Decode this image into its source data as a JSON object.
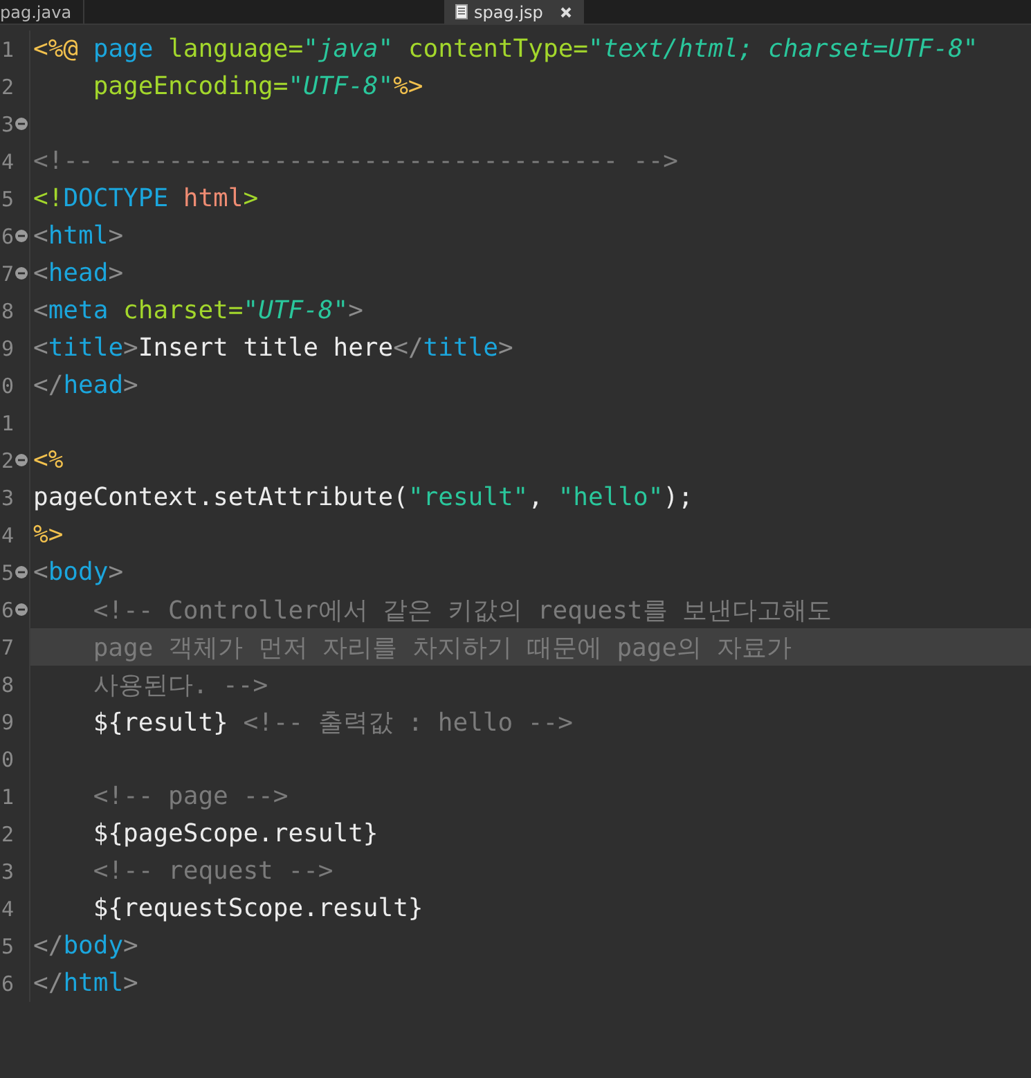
{
  "tabs": [
    {
      "label": "pag.java",
      "selected": false
    },
    {
      "label": "spag.jsp",
      "selected": true
    }
  ],
  "lines": [
    {
      "number": "1",
      "fold": false,
      "current": false,
      "tokens": [
        {
          "kind": "jsp",
          "text": "<%@"
        },
        {
          "kind": "tag",
          "text": " page"
        },
        {
          "kind": "attr",
          "text": " language="
        },
        {
          "kind": "str",
          "text": "\"java\""
        },
        {
          "kind": "attr",
          "text": " contentType="
        },
        {
          "kind": "str",
          "text": "\"text/html; charset=UTF-8\""
        }
      ]
    },
    {
      "number": "2",
      "fold": false,
      "current": false,
      "tokens": [
        {
          "kind": "attr",
          "text": "    pageEncoding="
        },
        {
          "kind": "str",
          "text": "\"UTF-8\""
        },
        {
          "kind": "jsp",
          "text": "%>"
        }
      ]
    },
    {
      "number": "3",
      "fold": true,
      "current": false
    },
    {
      "number": "4",
      "fold": false,
      "current": false,
      "tokens": [
        {
          "kind": "comment",
          "text": "<!-- ---------------------------------- -->"
        }
      ]
    },
    {
      "number": "5",
      "fold": false,
      "current": false,
      "tokens": [
        {
          "kind": "decl",
          "text": "<!"
        },
        {
          "kind": "tag",
          "text": "DOCTYPE"
        },
        {
          "kind": "name",
          "text": " html"
        },
        {
          "kind": "decl",
          "text": ">"
        }
      ]
    },
    {
      "number": "6",
      "fold": true,
      "current": false,
      "tokens": [
        {
          "kind": "punct",
          "text": "<"
        },
        {
          "kind": "tag",
          "text": "html"
        },
        {
          "kind": "punct",
          "text": ">"
        }
      ]
    },
    {
      "number": "7",
      "fold": true,
      "current": false,
      "tokens": [
        {
          "kind": "punct",
          "text": "<"
        },
        {
          "kind": "tag",
          "text": "head"
        },
        {
          "kind": "punct",
          "text": ">"
        }
      ]
    },
    {
      "number": "8",
      "fold": false,
      "current": false,
      "tokens": [
        {
          "kind": "punct",
          "text": "<"
        },
        {
          "kind": "tag",
          "text": "meta"
        },
        {
          "kind": "attr",
          "text": " charset="
        },
        {
          "kind": "str",
          "text": "\"UTF-8\""
        },
        {
          "kind": "punct",
          "text": ">"
        }
      ]
    },
    {
      "number": "9",
      "fold": false,
      "current": false,
      "tokens": [
        {
          "kind": "punct",
          "text": "<"
        },
        {
          "kind": "tag",
          "text": "title"
        },
        {
          "kind": "punct",
          "text": ">"
        },
        {
          "kind": "text",
          "text": "Insert title here"
        },
        {
          "kind": "punct",
          "text": "</"
        },
        {
          "kind": "tag",
          "text": "title"
        },
        {
          "kind": "punct",
          "text": ">"
        }
      ]
    },
    {
      "number": "0",
      "fold": false,
      "current": false,
      "tokens": [
        {
          "kind": "punct",
          "text": "</"
        },
        {
          "kind": "tag",
          "text": "head"
        },
        {
          "kind": "punct",
          "text": ">"
        }
      ]
    },
    {
      "number": "1",
      "fold": false,
      "current": false
    },
    {
      "number": "2",
      "fold": true,
      "current": false,
      "tokens": [
        {
          "kind": "jsp",
          "text": "<%"
        }
      ]
    },
    {
      "number": "3",
      "fold": false,
      "current": false,
      "tokens": [
        {
          "kind": "text",
          "text": "pageContext.setAttribute("
        },
        {
          "kind": "jstr",
          "text": "\"result\""
        },
        {
          "kind": "text",
          "text": ", "
        },
        {
          "kind": "jstr",
          "text": "\"hello\""
        },
        {
          "kind": "text",
          "text": ");"
        }
      ]
    },
    {
      "number": "4",
      "fold": false,
      "current": false,
      "tokens": [
        {
          "kind": "jsp",
          "text": "%>"
        }
      ]
    },
    {
      "number": "5",
      "fold": true,
      "current": false,
      "tokens": [
        {
          "kind": "punct",
          "text": "<"
        },
        {
          "kind": "tag",
          "text": "body"
        },
        {
          "kind": "punct",
          "text": ">"
        }
      ]
    },
    {
      "number": "6",
      "fold": true,
      "current": false,
      "tokens": [
        {
          "kind": "comment",
          "text": "    <!-- Controller에서 같은 키값의 request를 보낸다고해도"
        }
      ]
    },
    {
      "number": "7",
      "fold": false,
      "current": true,
      "tokens": [
        {
          "kind": "comment",
          "text": "    page 객체가 먼저 자리를 차지하기 때문에 page의 자료가"
        }
      ]
    },
    {
      "number": "8",
      "fold": false,
      "current": false,
      "tokens": [
        {
          "kind": "comment",
          "text": "    사용된다. -->"
        }
      ]
    },
    {
      "number": "9",
      "fold": false,
      "current": false,
      "tokens": [
        {
          "kind": "text",
          "text": "    ${result} "
        },
        {
          "kind": "comment",
          "text": "<!-- 출력값 : hello -->"
        }
      ]
    },
    {
      "number": "0",
      "fold": false,
      "current": false
    },
    {
      "number": "1",
      "fold": false,
      "current": false,
      "tokens": [
        {
          "kind": "comment",
          "text": "    <!-- page -->"
        }
      ]
    },
    {
      "number": "2",
      "fold": false,
      "current": false,
      "tokens": [
        {
          "kind": "text",
          "text": "    ${pageScope.result}"
        }
      ]
    },
    {
      "number": "3",
      "fold": false,
      "current": false,
      "tokens": [
        {
          "kind": "comment",
          "text": "    <!-- request -->"
        }
      ]
    },
    {
      "number": "4",
      "fold": false,
      "current": false,
      "tokens": [
        {
          "kind": "text",
          "text": "    ${requestScope.result}"
        }
      ]
    },
    {
      "number": "5",
      "fold": false,
      "current": false,
      "tokens": [
        {
          "kind": "punct",
          "text": "</"
        },
        {
          "kind": "tag",
          "text": "body"
        },
        {
          "kind": "punct",
          "text": ">"
        }
      ]
    },
    {
      "number": "6",
      "fold": false,
      "current": false,
      "tokens": [
        {
          "kind": "punct",
          "text": "</"
        },
        {
          "kind": "tag",
          "text": "html"
        },
        {
          "kind": "punct",
          "text": ">"
        }
      ]
    }
  ]
}
